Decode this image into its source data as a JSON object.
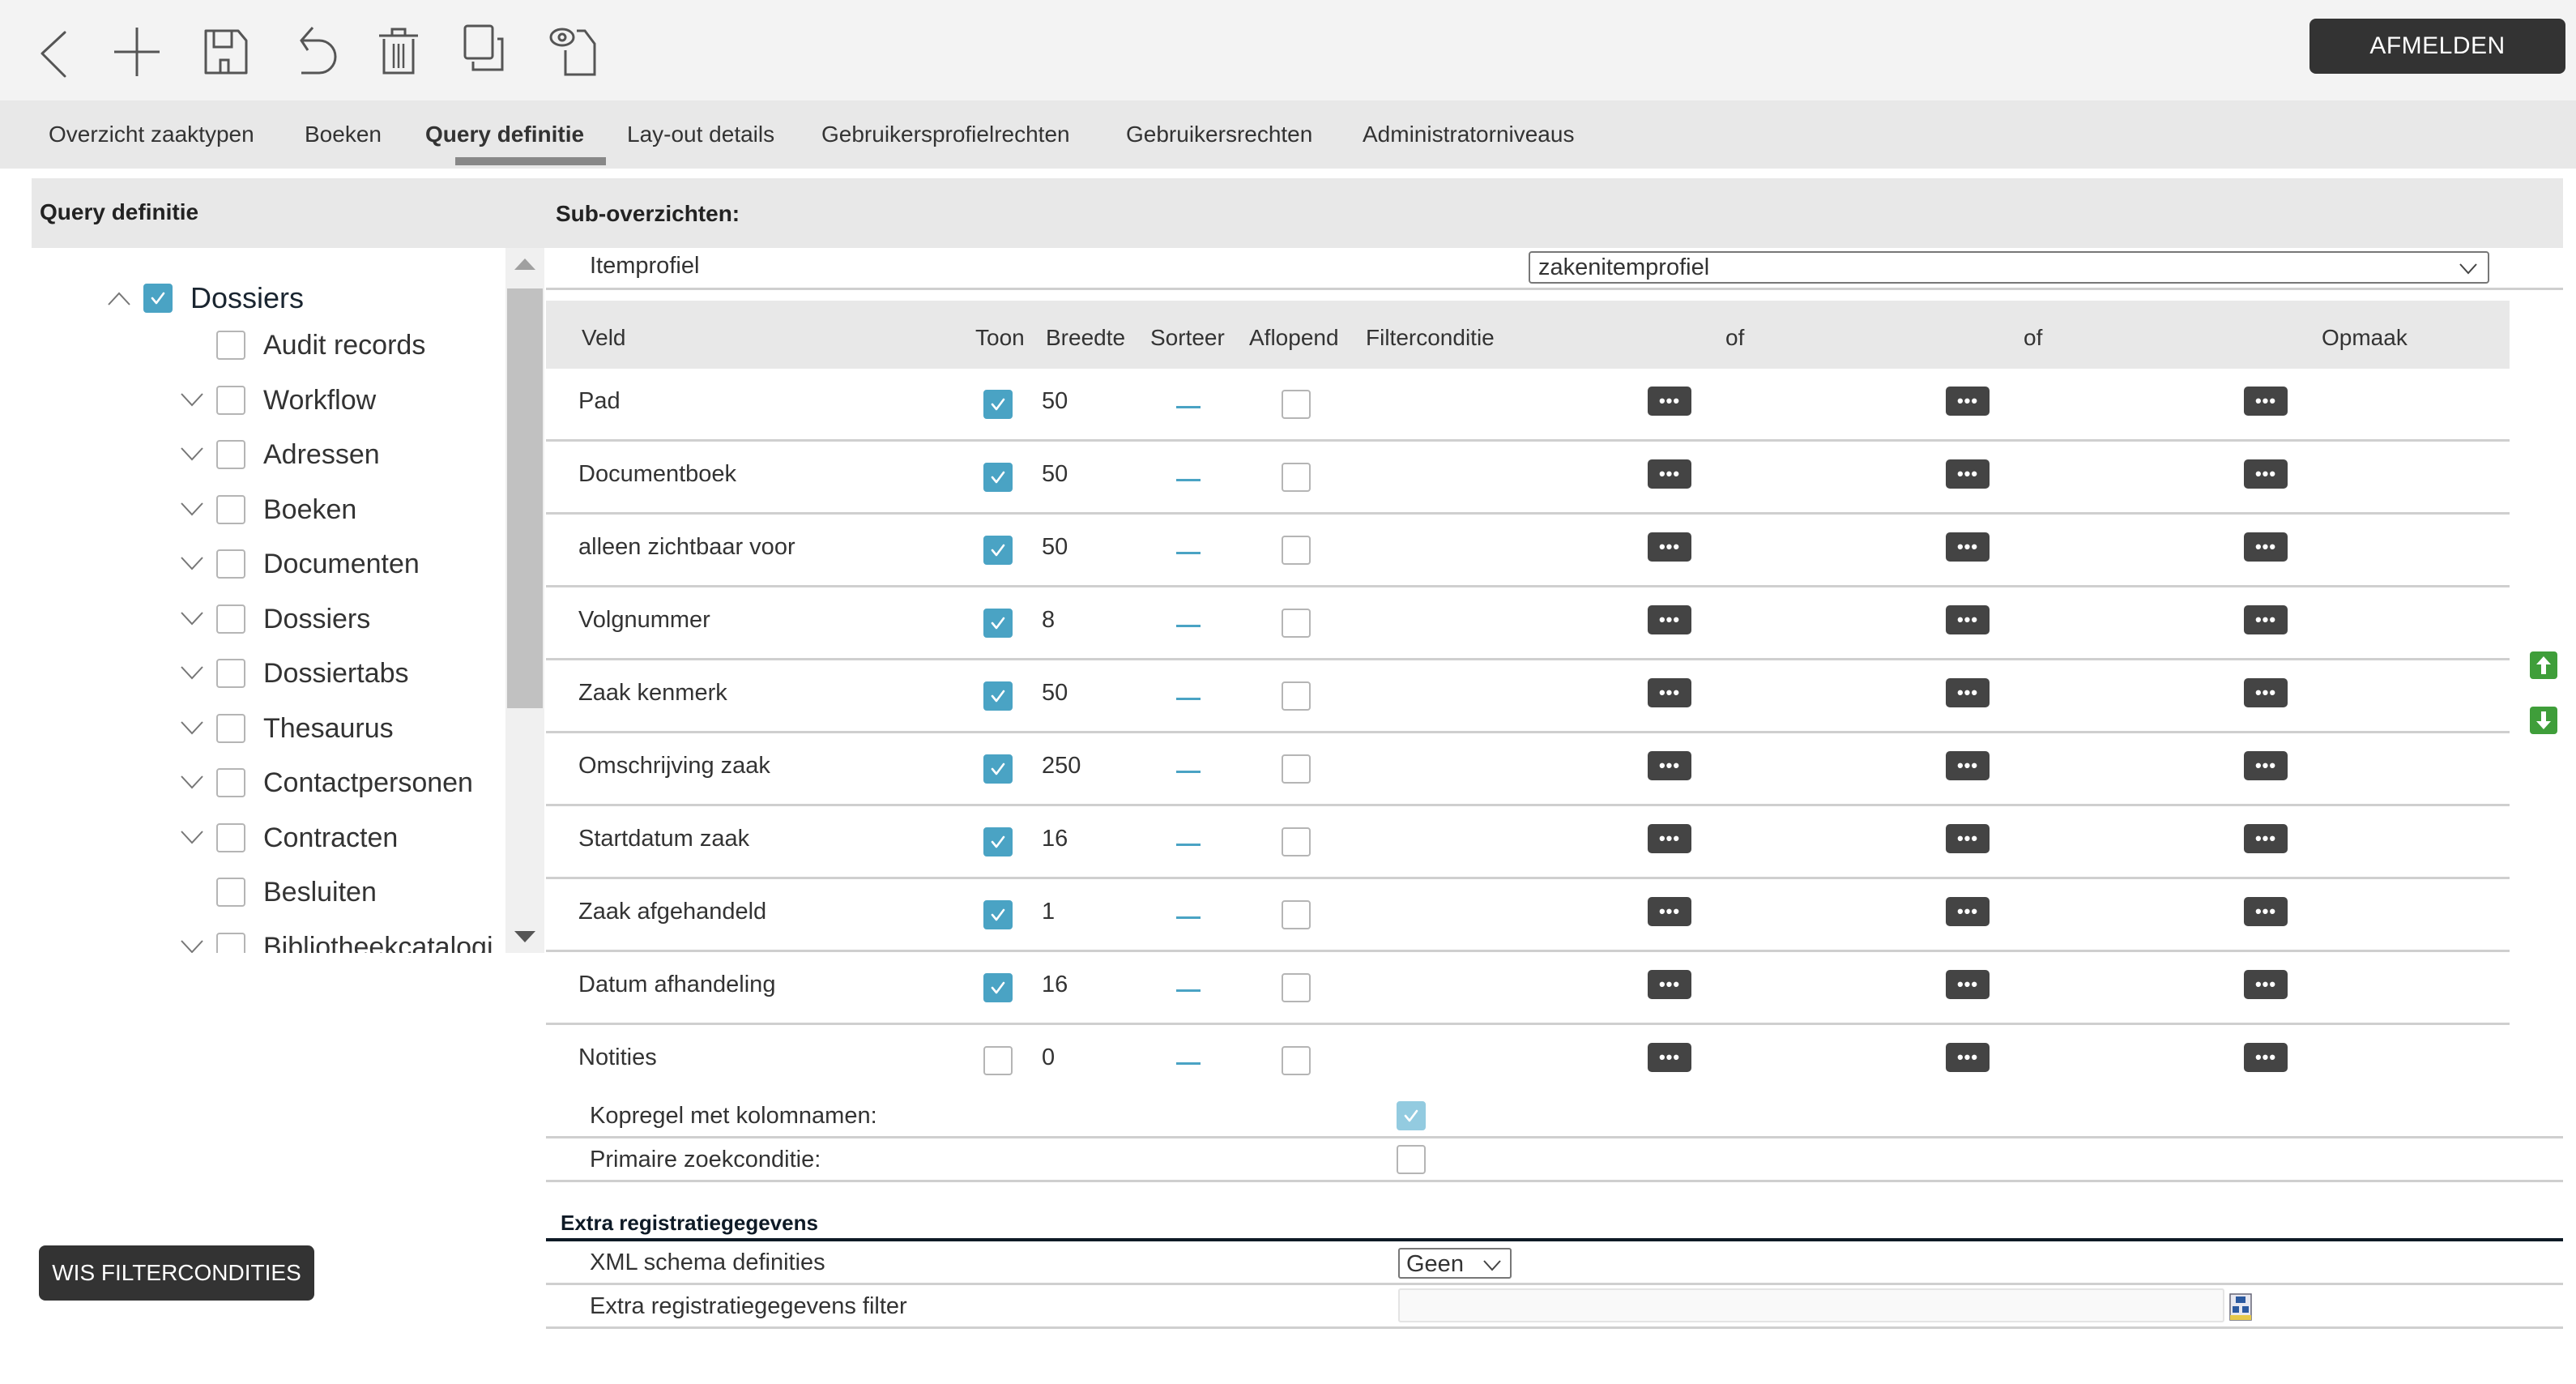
{
  "toolbar": {
    "icons": [
      "back-icon",
      "add-icon",
      "save-icon",
      "undo-icon",
      "delete-icon",
      "copy-icon",
      "preview-icon"
    ],
    "logout_label": "AFMELDEN"
  },
  "tabs": [
    {
      "label": "Overzicht zaaktypen",
      "active": false
    },
    {
      "label": "Boeken",
      "active": false
    },
    {
      "label": "Query definitie",
      "active": true
    },
    {
      "label": "Lay-out details",
      "active": false
    },
    {
      "label": "Gebruikersprofielrechten",
      "active": false
    },
    {
      "label": "Gebruikersrechten",
      "active": false
    },
    {
      "label": "Administratorniveaus",
      "active": false
    }
  ],
  "left_panel": {
    "title": "Query definitie",
    "tree": [
      {
        "label": "Dossiers",
        "checked": true,
        "expander": "up",
        "level": 0
      },
      {
        "label": "Audit records",
        "checked": false,
        "expander": "none",
        "level": 1
      },
      {
        "label": "Workflow",
        "checked": false,
        "expander": "down",
        "level": 1
      },
      {
        "label": "Adressen",
        "checked": false,
        "expander": "down",
        "level": 1
      },
      {
        "label": "Boeken",
        "checked": false,
        "expander": "down",
        "level": 1
      },
      {
        "label": "Documenten",
        "checked": false,
        "expander": "down",
        "level": 1
      },
      {
        "label": "Dossiers",
        "checked": false,
        "expander": "down",
        "level": 1
      },
      {
        "label": "Dossiertabs",
        "checked": false,
        "expander": "down",
        "level": 1
      },
      {
        "label": "Thesaurus",
        "checked": false,
        "expander": "down",
        "level": 1
      },
      {
        "label": "Contactpersonen",
        "checked": false,
        "expander": "down",
        "level": 1
      },
      {
        "label": "Contracten",
        "checked": false,
        "expander": "down",
        "level": 1
      },
      {
        "label": "Besluiten",
        "checked": false,
        "expander": "none",
        "level": 1
      },
      {
        "label": "Bibliotheekcatalogi",
        "checked": false,
        "expander": "down",
        "level": 1
      }
    ],
    "clear_button_label": "WIS FILTERCONDITIES"
  },
  "right_panel": {
    "title": "Sub-overzichten:",
    "itemprofiel_label": "Itemprofiel",
    "itemprofiel_value": "zakenitemprofiel",
    "columns": {
      "veld": "Veld",
      "toon": "Toon",
      "breedte": "Breedte",
      "sorteer": "Sorteer",
      "aflopend": "Aflopend",
      "filterconditie": "Filterconditie",
      "of1": "of",
      "of2": "of",
      "opmaak": "Opmaak"
    },
    "rows": [
      {
        "veld": "Pad",
        "toon": true,
        "breedte": "50",
        "aflopend": false
      },
      {
        "veld": "Documentboek",
        "toon": true,
        "breedte": "50",
        "aflopend": false
      },
      {
        "veld": "alleen zichtbaar voor",
        "toon": true,
        "breedte": "50",
        "aflopend": false
      },
      {
        "veld": "Volgnummer",
        "toon": true,
        "breedte": "8",
        "aflopend": false
      },
      {
        "veld": "Zaak kenmerk",
        "toon": true,
        "breedte": "50",
        "aflopend": false
      },
      {
        "veld": "Omschrijving zaak",
        "toon": true,
        "breedte": "250",
        "aflopend": false
      },
      {
        "veld": "Startdatum zaak",
        "toon": true,
        "breedte": "16",
        "aflopend": false
      },
      {
        "veld": "Zaak afgehandeld",
        "toon": true,
        "breedte": "1",
        "aflopend": false
      },
      {
        "veld": "Datum afhandeling",
        "toon": true,
        "breedte": "16",
        "aflopend": false
      },
      {
        "veld": "Notities",
        "toon": false,
        "breedte": "0",
        "aflopend": false
      }
    ],
    "dots_label": "•••",
    "kopregel_label": "Kopregel met kolomnamen:",
    "kopregel_checked": true,
    "primaire_label": "Primaire zoekconditie:",
    "primaire_checked": false,
    "extra": {
      "title": "Extra registratiegegevens",
      "xml_label": "XML schema definities",
      "xml_value": "Geen",
      "filter_label": "Extra registratiegegevens filter",
      "filter_value": ""
    },
    "move_up": "move-up-icon",
    "move_down": "move-down-icon"
  },
  "colors": {
    "accent_checkbox": "#4aa3c4",
    "dark_button": "#333333",
    "header_bg": "#e8e8e8",
    "toolbar_bg": "#f3f3f3",
    "move_green": "#3f9e3a"
  }
}
